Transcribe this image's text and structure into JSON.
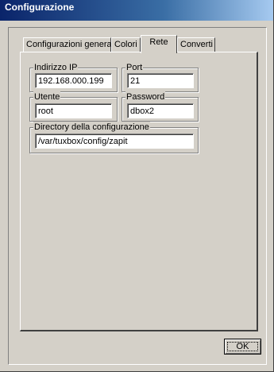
{
  "window": {
    "title": "Configurazione"
  },
  "tabs": [
    {
      "label": "Configurazioni generali",
      "active": false
    },
    {
      "label": "Colori",
      "active": false
    },
    {
      "label": "Rete",
      "active": true
    },
    {
      "label": "Converti",
      "active": false
    }
  ],
  "network": {
    "ip": {
      "label": "Indirizzo IP",
      "value": "192.168.000.199"
    },
    "port": {
      "label": "Port",
      "value": "21"
    },
    "user": {
      "label": "Utente",
      "value": "root"
    },
    "password": {
      "label": "Password",
      "value": "dbox2"
    },
    "config_dir": {
      "label": "Directory della configurazione",
      "value": "/var/tuxbox/config/zapit"
    }
  },
  "buttons": {
    "ok": "OK"
  },
  "colors": {
    "face": "#d4d0c8",
    "title_start": "#0a246a",
    "title_end": "#a6caf0"
  }
}
